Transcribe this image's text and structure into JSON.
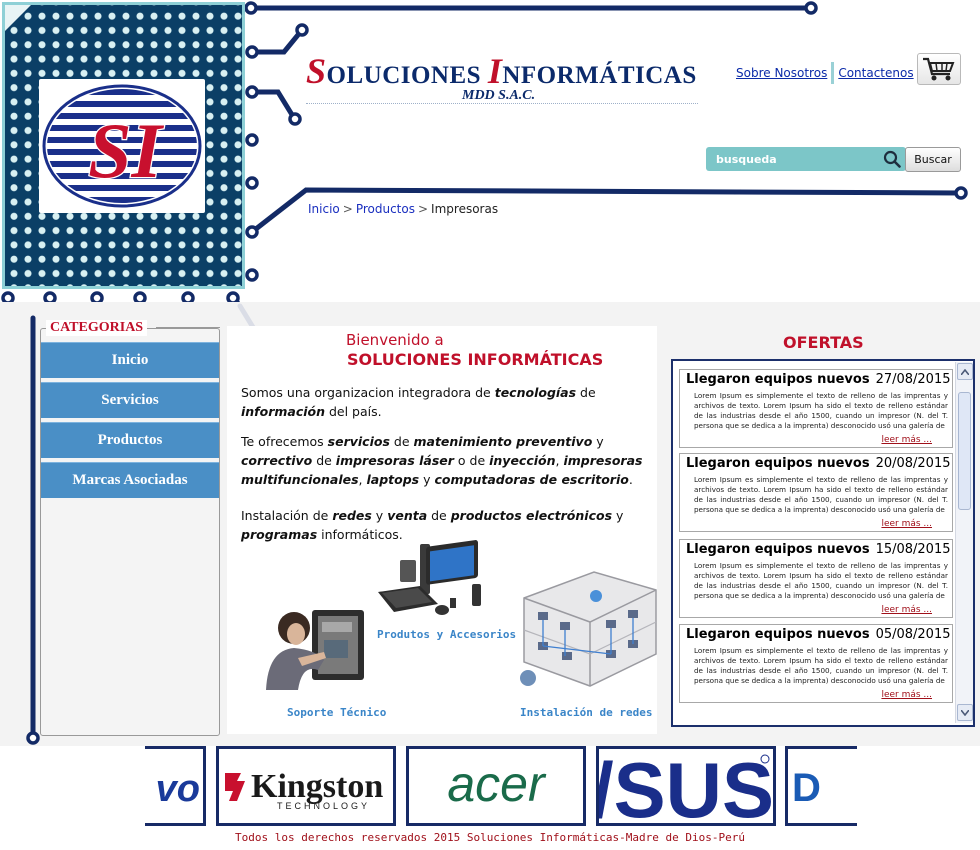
{
  "site": {
    "brand_title_cap1": "S",
    "brand_title_rest1": "OLUCIONES ",
    "brand_title_cap2": "I",
    "brand_title_rest2": "NFORMÁTICAS",
    "brand_subtitle": "MDD S.A.C.",
    "logo_text": "SI"
  },
  "header": {
    "links": [
      "Sobre Nosotros",
      "Contactenos"
    ],
    "cart_icon": "shopping-cart-icon"
  },
  "search": {
    "placeholder": "busqueda",
    "button_label": "Buscar",
    "icon": "search-icon"
  },
  "breadcrumb": {
    "items": [
      "Inicio",
      "Productos",
      "Impresoras"
    ],
    "separator": ">"
  },
  "sidebar": {
    "heading": "CATEGORIAS",
    "items": [
      "Inicio",
      "Servicios",
      "Productos",
      "Marcas Asociadas"
    ]
  },
  "welcome": {
    "line1": "Bienvenido a",
    "line2": "SOLUCIONES INFORMÁTICAS"
  },
  "intro": {
    "p1": [
      {
        "t": "Somos una organizacion integradora de ",
        "b": false
      },
      {
        "t": "tecnologías",
        "b": true
      },
      {
        "t": " de ",
        "b": false
      },
      {
        "t": "información",
        "b": true
      },
      {
        "t": " del país.",
        "b": false
      }
    ],
    "p2": [
      {
        "t": "Te ofrecemos ",
        "b": false
      },
      {
        "t": "servicios",
        "b": true
      },
      {
        "t": " de ",
        "b": false
      },
      {
        "t": "matenimiento preventivo",
        "b": true
      },
      {
        "t": " y ",
        "b": false
      },
      {
        "t": "correctivo",
        "b": true
      },
      {
        "t": " de ",
        "b": false
      },
      {
        "t": "impresoras láser",
        "b": true
      },
      {
        "t": " o de ",
        "b": false
      },
      {
        "t": "inyección",
        "b": true
      },
      {
        "t": ", ",
        "b": false
      },
      {
        "t": "impresoras multifuncionales",
        "b": true
      },
      {
        "t": ", ",
        "b": false
      },
      {
        "t": "laptops",
        "b": true
      },
      {
        "t": " y ",
        "b": false
      },
      {
        "t": "computadoras de escritorio",
        "b": true
      },
      {
        "t": ".",
        "b": false
      }
    ],
    "p3": [
      {
        "t": "Instalación de ",
        "b": false
      },
      {
        "t": "redes",
        "b": true
      },
      {
        "t": " y ",
        "b": false
      },
      {
        "t": "venta",
        "b": true
      },
      {
        "t": " de ",
        "b": false
      },
      {
        "t": "productos electrónicos",
        "b": true
      },
      {
        "t": " y ",
        "b": false
      },
      {
        "t": "programas",
        "b": true
      },
      {
        "t": " informáticos.",
        "b": false
      }
    ]
  },
  "services": [
    {
      "label": "Produtos y Accesorios",
      "icon": "computer-products-icon"
    },
    {
      "label": "Soporte Técnico",
      "icon": "technician-icon"
    },
    {
      "label": "Instalación de redes",
      "icon": "network-building-icon"
    }
  ],
  "ofertas": {
    "title": "OFERTAS",
    "read_more": "leer más ...",
    "items": [
      {
        "title": "Llegaron equipos nuevos",
        "date": "27/08/2015",
        "text": "Lorem Ipsum es simplemente el texto de relleno de las imprentas y archivos de texto. Lorem Ipsum ha sido el texto de relleno estándar de las industrias desde el año 1500, cuando un impresor (N. del T. persona que se dedica a la imprenta) desconocido usó una galería de"
      },
      {
        "title": "Llegaron equipos nuevos",
        "date": "20/08/2015",
        "text": "Lorem Ipsum es simplemente el texto de relleno de las imprentas y archivos de texto. Lorem Ipsum ha sido el texto de relleno estándar de las industrias desde el año 1500, cuando un impresor (N. del T. persona que se dedica a la imprenta) desconocido usó una galería de"
      },
      {
        "title": "Llegaron equipos nuevos",
        "date": "15/08/2015",
        "text": "Lorem Ipsum es simplemente el texto de relleno de las imprentas y archivos de texto. Lorem Ipsum ha sido el texto de relleno estándar de las industrias desde el año 1500, cuando un impresor (N. del T. persona que se dedica a la imprenta) desconocido usó una galería de"
      },
      {
        "title": "Llegaron equipos nuevos",
        "date": "05/08/2015",
        "text": "Lorem Ipsum es simplemente el texto de relleno de las imprentas y archivos de texto. Lorem Ipsum ha sido el texto de relleno estándar de las industrias desde el año 1500, cuando un impresor (N. del T. persona que se dedica a la imprenta) desconocido usó una galería de"
      }
    ]
  },
  "brands": {
    "items": [
      "vo",
      "Kingston",
      "TECHNOLOGY",
      "acer",
      "/SUS",
      "D"
    ]
  },
  "footer": {
    "text": "Todos los derechos reservados 2015 Soluciones Informáticas-Madre de Dios-Perú"
  },
  "colors": {
    "navy": "#0b2a6b",
    "brand_red": "#c0102a",
    "teal": "#7cc6c8",
    "menu_blue": "#4a8fc6"
  }
}
